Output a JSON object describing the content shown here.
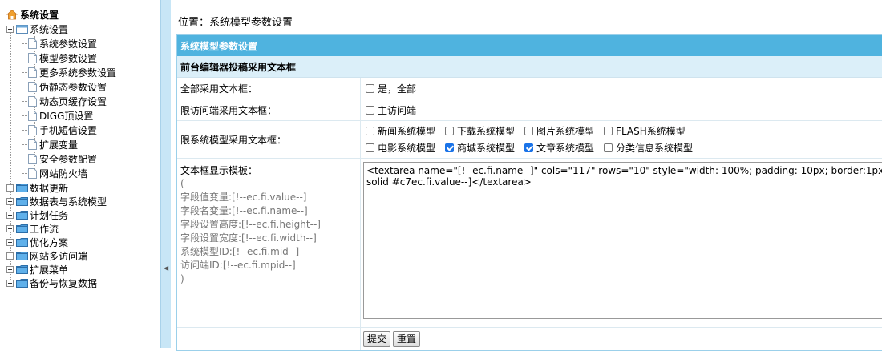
{
  "sidebar": {
    "root_label": "系统设置",
    "group_label": "系统设置",
    "children": [
      "系统参数设置",
      "模型参数设置",
      "更多系统参数设置",
      "伪静态参数设置",
      "动态页缓存设置",
      "DIGG顶设置",
      "手机短信设置",
      "扩展变量",
      "安全参数配置",
      "网站防火墙"
    ],
    "groups": [
      "数据更新",
      "数据表与系统模型",
      "计划任务",
      "工作流",
      "优化方案",
      "网站多访问端",
      "扩展菜单",
      "备份与恢复数据"
    ]
  },
  "breadcrumb": "位置：系统模型参数设置",
  "panel": {
    "title": "系统模型参数设置",
    "subtitle": "前台编辑器投稿采用文本框",
    "rows": {
      "all": {
        "label": "全部采用文本框：",
        "option": "是，全部"
      },
      "client": {
        "label": "限访问端采用文本框：",
        "option": "主访问端"
      },
      "models": {
        "label": "限系统模型采用文本框：",
        "options": [
          {
            "text": "新闻系统模型",
            "checked": false
          },
          {
            "text": "下载系统模型",
            "checked": false
          },
          {
            "text": "图片系统模型",
            "checked": false
          },
          {
            "text": "FLASH系统模型",
            "checked": false
          },
          {
            "text": "电影系统模型",
            "checked": false
          },
          {
            "text": "商城系统模型",
            "checked": true
          },
          {
            "text": "文章系统模型",
            "checked": true
          },
          {
            "text": "分类信息系统模型",
            "checked": false
          }
        ]
      },
      "template": {
        "label": "文本框显示模板：",
        "help": [
          "(",
          "字段值变量:[!--ec.fi.value--]",
          "字段名变量:[!--ec.fi.name--]",
          "字段设置高度:[!--ec.fi.height--]",
          "字段设置宽度:[!--ec.fi.width--]",
          "系统模型ID:[!--ec.fi.mid--]",
          "访问端ID:[!--ec.fi.mpid--]",
          ")"
        ],
        "value": "<textarea name=\"[!--ec.fi.name--]\" cols=\"117\" rows=\"10\" style=\"width: 100%; padding: 10px; border:1px solid #c7ec.fi.value--]</textarea>"
      }
    },
    "submit_label": "提交",
    "reset_label": "重置"
  }
}
